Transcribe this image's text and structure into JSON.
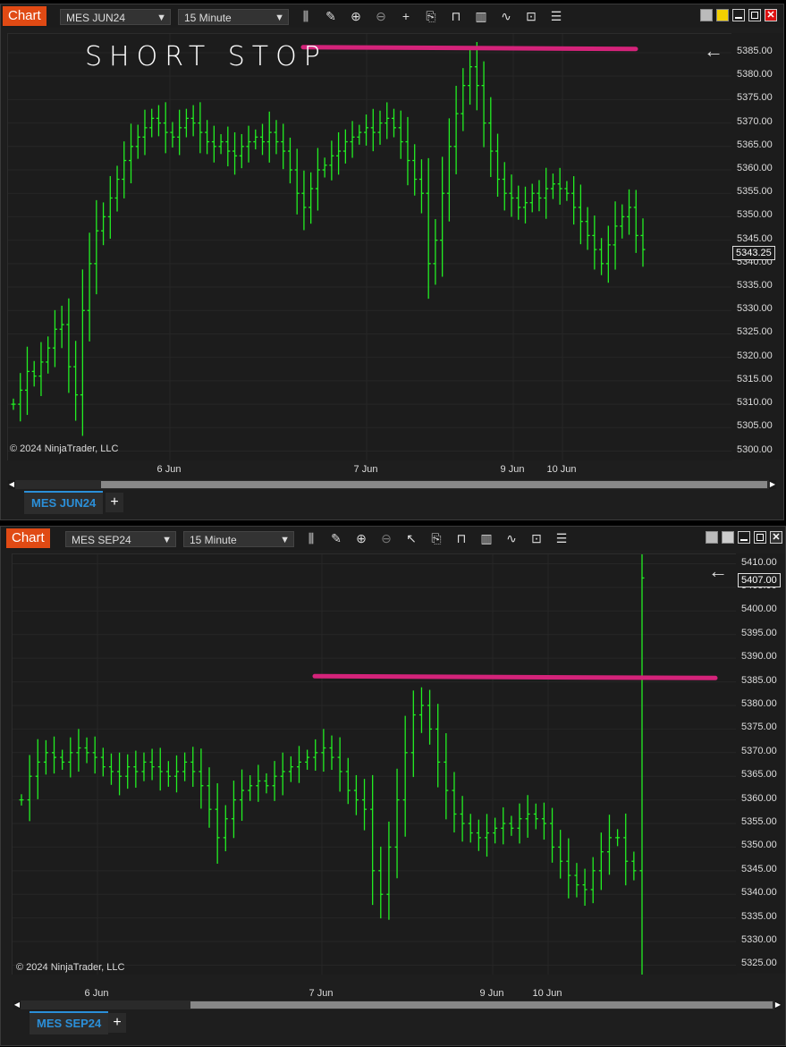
{
  "windows": [
    {
      "id": "top",
      "title_tab": "Chart",
      "instrument": "MES JUN24",
      "interval": "15 Minute",
      "instrument_tab": "MES JUN24",
      "copyright": "© 2024 NinjaTrader, LLC",
      "price_axis": [
        "5385.00",
        "5380.00",
        "5375.00",
        "5370.00",
        "5365.00",
        "5360.00",
        "5355.00",
        "5350.00",
        "5345.00",
        "5340.00",
        "5335.00",
        "5330.00",
        "5325.00",
        "5320.00",
        "5315.00",
        "5310.00",
        "5305.00",
        "5300.00"
      ],
      "last_price": "5343.25",
      "time_axis": [
        "6 Jun",
        "7 Jun",
        "9 Jun",
        "10 Jun"
      ],
      "annotation_text": "SHORT STOP",
      "level_line_price": 5386,
      "line_color": "#d4237a",
      "bar_color": "#22ee22"
    },
    {
      "id": "bottom",
      "title_tab": "Chart",
      "instrument": "MES SEP24",
      "interval": "15 Minute",
      "instrument_tab": "MES SEP24",
      "copyright": "© 2024 NinjaTrader, LLC",
      "price_axis": [
        "5410.00",
        "5405.00",
        "5400.00",
        "5395.00",
        "5390.00",
        "5385.00",
        "5380.00",
        "5375.00",
        "5370.00",
        "5365.00",
        "5360.00",
        "5355.00",
        "5350.00",
        "5345.00",
        "5340.00",
        "5335.00",
        "5330.00",
        "5325.00"
      ],
      "last_price": "5407.00",
      "time_axis": [
        "6 Jun",
        "7 Jun",
        "9 Jun",
        "10 Jun"
      ],
      "level_line_price": 5386,
      "line_color": "#d4237a",
      "bar_color": "#22ee22"
    }
  ],
  "toolbar_icons": [
    "bar-style-icon",
    "pencil-icon",
    "zoom-in-icon",
    "zoom-out-icon",
    "crosshair-icon",
    "data-box-icon",
    "properties-icon",
    "indicators-icon",
    "strategies-icon",
    "template-icon",
    "list-icon"
  ],
  "chart_data": [
    {
      "type": "bar",
      "title": "",
      "series_name": "",
      "ylim": [
        5298,
        5389
      ],
      "x_ticks": [
        "6 Jun",
        "7 Jun",
        "9 Jun",
        "10 Jun"
      ],
      "ohlc_closes": [
        5310,
        5313,
        5317,
        5316,
        5319,
        5322,
        5326,
        5327,
        5318,
        5312,
        5330,
        5340,
        5347,
        5350,
        5354,
        5358,
        5362,
        5365,
        5367,
        5369,
        5371,
        5370,
        5368,
        5367,
        5369,
        5371,
        5370,
        5368,
        5366,
        5365,
        5366,
        5364,
        5363,
        5365,
        5366,
        5367,
        5366,
        5368,
        5366,
        5364,
        5360,
        5355,
        5352,
        5356,
        5360,
        5361,
        5363,
        5364,
        5366,
        5367,
        5368,
        5369,
        5368,
        5370,
        5371,
        5369,
        5366,
        5362,
        5358,
        5355,
        5340,
        5345,
        5355,
        5365,
        5372,
        5378,
        5382,
        5378,
        5370,
        5364,
        5358,
        5355,
        5354,
        5352,
        5353,
        5355,
        5354,
        5356,
        5357,
        5356,
        5355,
        5352,
        5349,
        5346,
        5343,
        5340,
        5344,
        5348,
        5350,
        5352,
        5346,
        5343
      ],
      "level_line": 5386
    },
    {
      "type": "bar",
      "title": "",
      "series_name": "",
      "ylim": [
        5323,
        5412
      ],
      "x_ticks": [
        "6 Jun",
        "7 Jun",
        "9 Jun",
        "10 Jun"
      ],
      "ohlc_closes": [
        5360,
        5365,
        5368,
        5370,
        5369,
        5368,
        5370,
        5371,
        5370,
        5369,
        5367,
        5366,
        5365,
        5367,
        5366,
        5368,
        5367,
        5366,
        5365,
        5366,
        5368,
        5366,
        5363,
        5358,
        5352,
        5356,
        5360,
        5362,
        5363,
        5364,
        5363,
        5365,
        5366,
        5367,
        5368,
        5369,
        5370,
        5371,
        5369,
        5366,
        5362,
        5360,
        5358,
        5345,
        5340,
        5350,
        5360,
        5370,
        5378,
        5380,
        5375,
        5368,
        5362,
        5357,
        5355,
        5353,
        5352,
        5353,
        5354,
        5355,
        5354,
        5356,
        5357,
        5356,
        5355,
        5350,
        5347,
        5344,
        5342,
        5341,
        5345,
        5349,
        5352,
        5352,
        5347,
        5345,
        5407
      ],
      "level_line": 5386,
      "last_price": 5407.0
    }
  ]
}
